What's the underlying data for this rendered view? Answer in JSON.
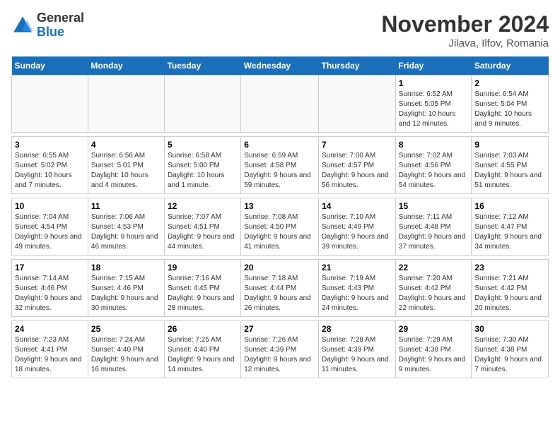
{
  "header": {
    "logo_general": "General",
    "logo_blue": "Blue",
    "month_title": "November 2024",
    "location": "Jilava, Ilfov, Romania"
  },
  "weekdays": [
    "Sunday",
    "Monday",
    "Tuesday",
    "Wednesday",
    "Thursday",
    "Friday",
    "Saturday"
  ],
  "weeks": [
    [
      {
        "day": "",
        "info": ""
      },
      {
        "day": "",
        "info": ""
      },
      {
        "day": "",
        "info": ""
      },
      {
        "day": "",
        "info": ""
      },
      {
        "day": "",
        "info": ""
      },
      {
        "day": "1",
        "info": "Sunrise: 6:52 AM\nSunset: 5:05 PM\nDaylight: 10 hours and 12 minutes."
      },
      {
        "day": "2",
        "info": "Sunrise: 6:54 AM\nSunset: 5:04 PM\nDaylight: 10 hours and 9 minutes."
      }
    ],
    [
      {
        "day": "3",
        "info": "Sunrise: 6:55 AM\nSunset: 5:02 PM\nDaylight: 10 hours and 7 minutes."
      },
      {
        "day": "4",
        "info": "Sunrise: 6:56 AM\nSunset: 5:01 PM\nDaylight: 10 hours and 4 minutes."
      },
      {
        "day": "5",
        "info": "Sunrise: 6:58 AM\nSunset: 5:00 PM\nDaylight: 10 hours and 1 minute."
      },
      {
        "day": "6",
        "info": "Sunrise: 6:59 AM\nSunset: 4:58 PM\nDaylight: 9 hours and 59 minutes."
      },
      {
        "day": "7",
        "info": "Sunrise: 7:00 AM\nSunset: 4:57 PM\nDaylight: 9 hours and 56 minutes."
      },
      {
        "day": "8",
        "info": "Sunrise: 7:02 AM\nSunset: 4:56 PM\nDaylight: 9 hours and 54 minutes."
      },
      {
        "day": "9",
        "info": "Sunrise: 7:03 AM\nSunset: 4:55 PM\nDaylight: 9 hours and 51 minutes."
      }
    ],
    [
      {
        "day": "10",
        "info": "Sunrise: 7:04 AM\nSunset: 4:54 PM\nDaylight: 9 hours and 49 minutes."
      },
      {
        "day": "11",
        "info": "Sunrise: 7:06 AM\nSunset: 4:53 PM\nDaylight: 9 hours and 46 minutes."
      },
      {
        "day": "12",
        "info": "Sunrise: 7:07 AM\nSunset: 4:51 PM\nDaylight: 9 hours and 44 minutes."
      },
      {
        "day": "13",
        "info": "Sunrise: 7:08 AM\nSunset: 4:50 PM\nDaylight: 9 hours and 41 minutes."
      },
      {
        "day": "14",
        "info": "Sunrise: 7:10 AM\nSunset: 4:49 PM\nDaylight: 9 hours and 39 minutes."
      },
      {
        "day": "15",
        "info": "Sunrise: 7:11 AM\nSunset: 4:48 PM\nDaylight: 9 hours and 37 minutes."
      },
      {
        "day": "16",
        "info": "Sunrise: 7:12 AM\nSunset: 4:47 PM\nDaylight: 9 hours and 34 minutes."
      }
    ],
    [
      {
        "day": "17",
        "info": "Sunrise: 7:14 AM\nSunset: 4:46 PM\nDaylight: 9 hours and 32 minutes."
      },
      {
        "day": "18",
        "info": "Sunrise: 7:15 AM\nSunset: 4:46 PM\nDaylight: 9 hours and 30 minutes."
      },
      {
        "day": "19",
        "info": "Sunrise: 7:16 AM\nSunset: 4:45 PM\nDaylight: 9 hours and 28 minutes."
      },
      {
        "day": "20",
        "info": "Sunrise: 7:18 AM\nSunset: 4:44 PM\nDaylight: 9 hours and 26 minutes."
      },
      {
        "day": "21",
        "info": "Sunrise: 7:19 AM\nSunset: 4:43 PM\nDaylight: 9 hours and 24 minutes."
      },
      {
        "day": "22",
        "info": "Sunrise: 7:20 AM\nSunset: 4:42 PM\nDaylight: 9 hours and 22 minutes."
      },
      {
        "day": "23",
        "info": "Sunrise: 7:21 AM\nSunset: 4:42 PM\nDaylight: 9 hours and 20 minutes."
      }
    ],
    [
      {
        "day": "24",
        "info": "Sunrise: 7:23 AM\nSunset: 4:41 PM\nDaylight: 9 hours and 18 minutes."
      },
      {
        "day": "25",
        "info": "Sunrise: 7:24 AM\nSunset: 4:40 PM\nDaylight: 9 hours and 16 minutes."
      },
      {
        "day": "26",
        "info": "Sunrise: 7:25 AM\nSunset: 4:40 PM\nDaylight: 9 hours and 14 minutes."
      },
      {
        "day": "27",
        "info": "Sunrise: 7:26 AM\nSunset: 4:39 PM\nDaylight: 9 hours and 12 minutes."
      },
      {
        "day": "28",
        "info": "Sunrise: 7:28 AM\nSunset: 4:39 PM\nDaylight: 9 hours and 11 minutes."
      },
      {
        "day": "29",
        "info": "Sunrise: 7:29 AM\nSunset: 4:38 PM\nDaylight: 9 hours and 9 minutes."
      },
      {
        "day": "30",
        "info": "Sunrise: 7:30 AM\nSunset: 4:38 PM\nDaylight: 9 hours and 7 minutes."
      }
    ]
  ]
}
